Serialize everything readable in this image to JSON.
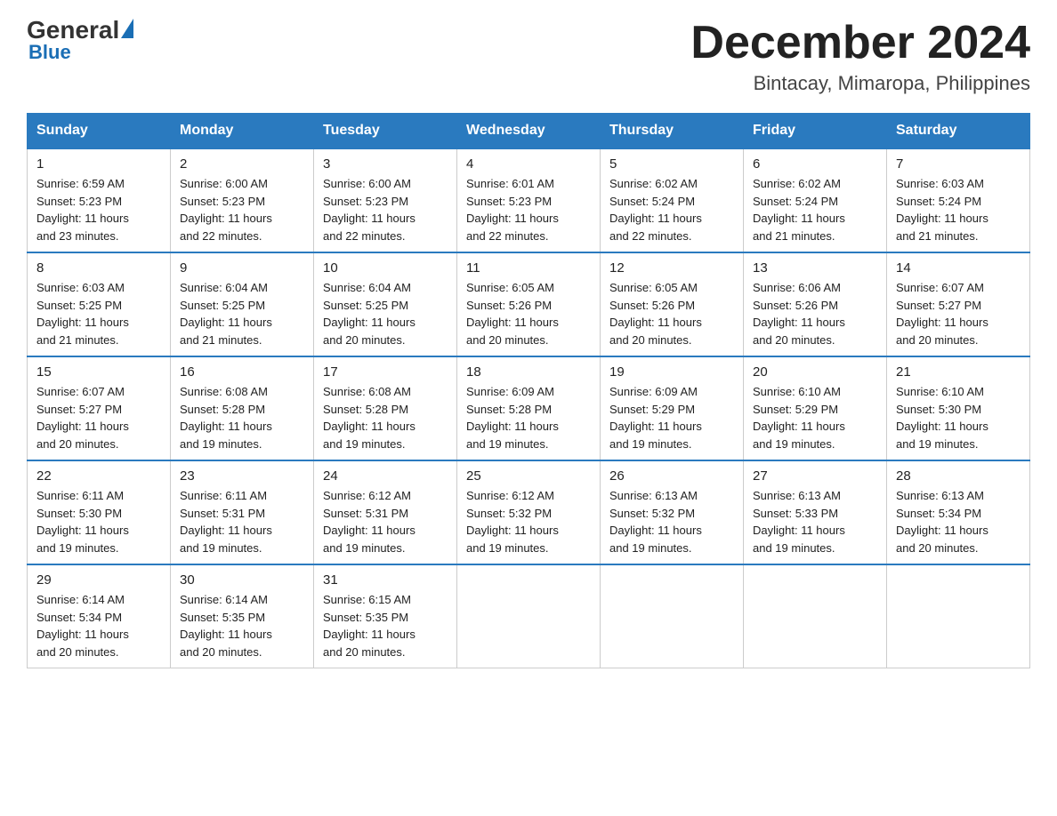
{
  "header": {
    "logo_general": "General",
    "logo_blue": "Blue",
    "month_title": "December 2024",
    "location": "Bintacay, Mimaropa, Philippines"
  },
  "days_of_week": [
    "Sunday",
    "Monday",
    "Tuesday",
    "Wednesday",
    "Thursday",
    "Friday",
    "Saturday"
  ],
  "weeks": [
    [
      {
        "day": "1",
        "sunrise": "6:59 AM",
        "sunset": "5:23 PM",
        "daylight": "11 hours and 23 minutes."
      },
      {
        "day": "2",
        "sunrise": "6:00 AM",
        "sunset": "5:23 PM",
        "daylight": "11 hours and 22 minutes."
      },
      {
        "day": "3",
        "sunrise": "6:00 AM",
        "sunset": "5:23 PM",
        "daylight": "11 hours and 22 minutes."
      },
      {
        "day": "4",
        "sunrise": "6:01 AM",
        "sunset": "5:23 PM",
        "daylight": "11 hours and 22 minutes."
      },
      {
        "day": "5",
        "sunrise": "6:02 AM",
        "sunset": "5:24 PM",
        "daylight": "11 hours and 22 minutes."
      },
      {
        "day": "6",
        "sunrise": "6:02 AM",
        "sunset": "5:24 PM",
        "daylight": "11 hours and 21 minutes."
      },
      {
        "day": "7",
        "sunrise": "6:03 AM",
        "sunset": "5:24 PM",
        "daylight": "11 hours and 21 minutes."
      }
    ],
    [
      {
        "day": "8",
        "sunrise": "6:03 AM",
        "sunset": "5:25 PM",
        "daylight": "11 hours and 21 minutes."
      },
      {
        "day": "9",
        "sunrise": "6:04 AM",
        "sunset": "5:25 PM",
        "daylight": "11 hours and 21 minutes."
      },
      {
        "day": "10",
        "sunrise": "6:04 AM",
        "sunset": "5:25 PM",
        "daylight": "11 hours and 20 minutes."
      },
      {
        "day": "11",
        "sunrise": "6:05 AM",
        "sunset": "5:26 PM",
        "daylight": "11 hours and 20 minutes."
      },
      {
        "day": "12",
        "sunrise": "6:05 AM",
        "sunset": "5:26 PM",
        "daylight": "11 hours and 20 minutes."
      },
      {
        "day": "13",
        "sunrise": "6:06 AM",
        "sunset": "5:26 PM",
        "daylight": "11 hours and 20 minutes."
      },
      {
        "day": "14",
        "sunrise": "6:07 AM",
        "sunset": "5:27 PM",
        "daylight": "11 hours and 20 minutes."
      }
    ],
    [
      {
        "day": "15",
        "sunrise": "6:07 AM",
        "sunset": "5:27 PM",
        "daylight": "11 hours and 20 minutes."
      },
      {
        "day": "16",
        "sunrise": "6:08 AM",
        "sunset": "5:28 PM",
        "daylight": "11 hours and 19 minutes."
      },
      {
        "day": "17",
        "sunrise": "6:08 AM",
        "sunset": "5:28 PM",
        "daylight": "11 hours and 19 minutes."
      },
      {
        "day": "18",
        "sunrise": "6:09 AM",
        "sunset": "5:28 PM",
        "daylight": "11 hours and 19 minutes."
      },
      {
        "day": "19",
        "sunrise": "6:09 AM",
        "sunset": "5:29 PM",
        "daylight": "11 hours and 19 minutes."
      },
      {
        "day": "20",
        "sunrise": "6:10 AM",
        "sunset": "5:29 PM",
        "daylight": "11 hours and 19 minutes."
      },
      {
        "day": "21",
        "sunrise": "6:10 AM",
        "sunset": "5:30 PM",
        "daylight": "11 hours and 19 minutes."
      }
    ],
    [
      {
        "day": "22",
        "sunrise": "6:11 AM",
        "sunset": "5:30 PM",
        "daylight": "11 hours and 19 minutes."
      },
      {
        "day": "23",
        "sunrise": "6:11 AM",
        "sunset": "5:31 PM",
        "daylight": "11 hours and 19 minutes."
      },
      {
        "day": "24",
        "sunrise": "6:12 AM",
        "sunset": "5:31 PM",
        "daylight": "11 hours and 19 minutes."
      },
      {
        "day": "25",
        "sunrise": "6:12 AM",
        "sunset": "5:32 PM",
        "daylight": "11 hours and 19 minutes."
      },
      {
        "day": "26",
        "sunrise": "6:13 AM",
        "sunset": "5:32 PM",
        "daylight": "11 hours and 19 minutes."
      },
      {
        "day": "27",
        "sunrise": "6:13 AM",
        "sunset": "5:33 PM",
        "daylight": "11 hours and 19 minutes."
      },
      {
        "day": "28",
        "sunrise": "6:13 AM",
        "sunset": "5:34 PM",
        "daylight": "11 hours and 20 minutes."
      }
    ],
    [
      {
        "day": "29",
        "sunrise": "6:14 AM",
        "sunset": "5:34 PM",
        "daylight": "11 hours and 20 minutes."
      },
      {
        "day": "30",
        "sunrise": "6:14 AM",
        "sunset": "5:35 PM",
        "daylight": "11 hours and 20 minutes."
      },
      {
        "day": "31",
        "sunrise": "6:15 AM",
        "sunset": "5:35 PM",
        "daylight": "11 hours and 20 minutes."
      },
      null,
      null,
      null,
      null
    ]
  ]
}
